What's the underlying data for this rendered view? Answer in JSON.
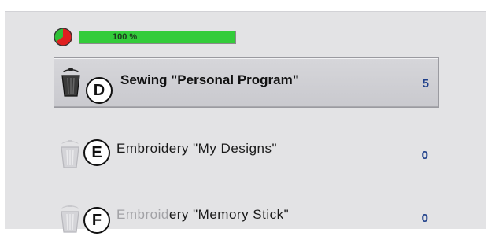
{
  "storage": {
    "usage_percent": 100,
    "usage_label": "100 %",
    "pie_icon": "memory-usage-pie-icon",
    "fill_color": "#33cc3a",
    "pie_colors": {
      "used": "#e02020",
      "free": "#2fbf36"
    }
  },
  "folders": [
    {
      "callout": "D",
      "label_dim": "",
      "label": "Sewing \"Personal Program\"",
      "count": "5",
      "selected": true,
      "icon": "trash-icon"
    },
    {
      "callout": "E",
      "label_dim": "",
      "label": "Embroidery \"My Designs\"",
      "count": "0",
      "selected": false,
      "icon": "trash-icon"
    },
    {
      "callout": "F",
      "label_dim": "Embroid",
      "label": "ery \"Memory Stick\"",
      "count": "0",
      "selected": false,
      "icon": "trash-icon"
    }
  ],
  "colors": {
    "count_text": "#1e3f8a",
    "panel_bg": "#e3e3e5",
    "selected_bg": "#cfcfd3"
  }
}
